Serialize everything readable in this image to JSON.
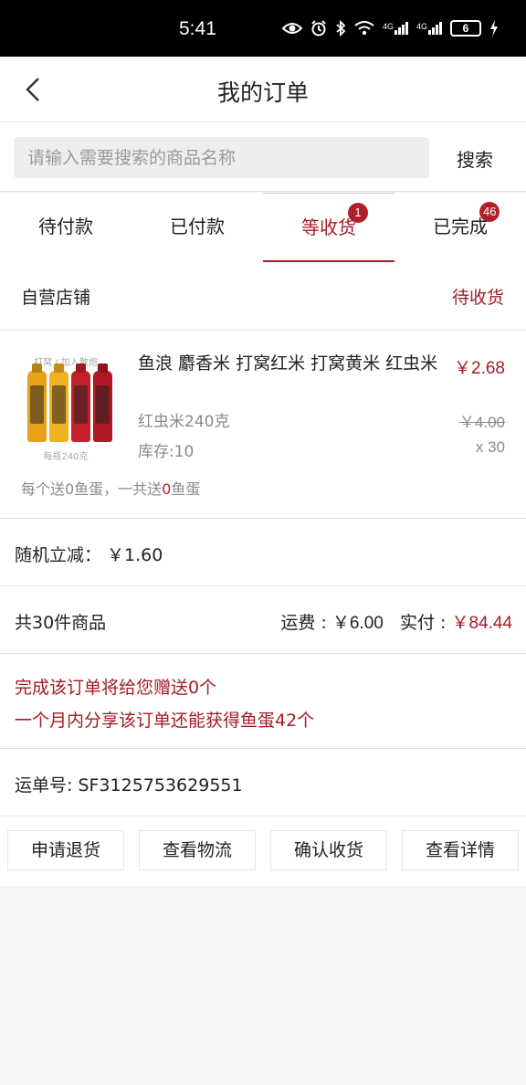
{
  "status_bar": {
    "time": "5:41",
    "icons": [
      "eye-icon",
      "alarm-icon",
      "bluetooth-icon",
      "wifi-icon",
      "signal-4g-icon",
      "signal-4g-icon",
      "battery-icon",
      "charging-icon"
    ],
    "network_1": "4G",
    "network_2": "4G",
    "battery": "6"
  },
  "header": {
    "title": "我的订单"
  },
  "search": {
    "placeholder": "请输入需要搜索的商品名称",
    "button_label": "搜索"
  },
  "tabs": [
    {
      "label": "待付款",
      "badge": ""
    },
    {
      "label": "已付款",
      "badge": ""
    },
    {
      "label": "等收货",
      "badge": "1",
      "active": true
    },
    {
      "label": "已完成",
      "badge": "46"
    }
  ],
  "order": {
    "shop_name": "自营店铺",
    "status": "待收货",
    "product": {
      "name": "鱼浪 麝香米 打窝红米 打窝黄米 红虫米",
      "price": "￥2.68",
      "spec": "红虫米240克",
      "original_price": "￥4.00",
      "stock": "库存:10",
      "quantity": "x 30",
      "image_caption_top": "打窝 / 加入散炮",
      "image_caption_bottom": "每瓶240克"
    },
    "gift_note": {
      "part1": "每个送0鱼蛋，一共送",
      "highlight": "0",
      "part2": "鱼蛋"
    },
    "discount": "随机立减： ￥1.60",
    "item_count": "共30件商品",
    "shipping_label": "运费 : ",
    "shipping_value": "￥6.00",
    "paid_label": "实付 : ",
    "paid_value": "￥84.44",
    "promo_line_1": "完成该订单将给您赠送0个",
    "promo_line_2": "一个月内分享该订单还能获得鱼蛋42个",
    "tracking": "运单号: SF3125753629551",
    "actions": [
      "申请退货",
      "查看物流",
      "确认收货",
      "查看详情"
    ]
  },
  "colors": {
    "accent": "#a31c26",
    "badge": "#b11f2a",
    "background": "#f5f5f5"
  }
}
